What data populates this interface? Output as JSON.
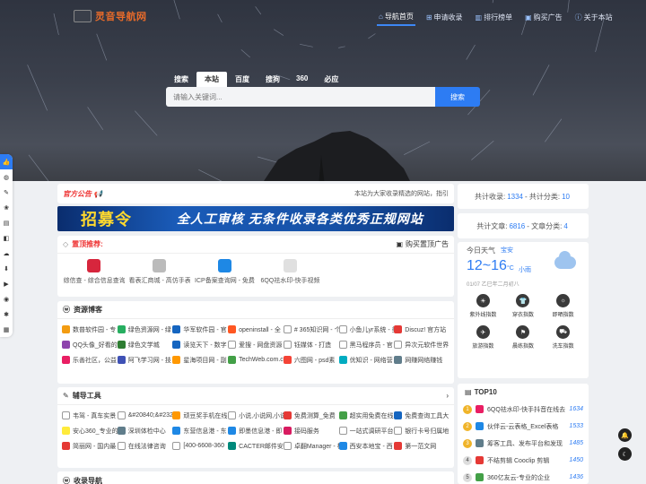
{
  "header": {
    "logo_text": "灵音导航网",
    "nav": [
      {
        "label": "导航首页",
        "icon": "home-icon"
      },
      {
        "label": "申请收录",
        "icon": "plus-icon"
      },
      {
        "label": "排行榜单",
        "icon": "bar-chart-icon"
      },
      {
        "label": "购买广告",
        "icon": "cart-icon"
      },
      {
        "label": "关于本站",
        "icon": "info-icon"
      }
    ]
  },
  "search": {
    "tabs": [
      "搜索",
      "本站",
      "百度",
      "搜狗",
      "360",
      "必应"
    ],
    "placeholder": "请输入关键词...",
    "button": "搜索"
  },
  "notice": {
    "title": "官方公告",
    "message": "本站为大家收录精选的网站，指引"
  },
  "banner": {
    "headline": "招募令",
    "slogan": "全人工审核  无条件收录各类优秀正规网站"
  },
  "top_recommend": {
    "title": "置顶推荐:",
    "buy": "购买置顶广告",
    "items": [
      {
        "name": "综信查 - 综合信息查询",
        "color": "#d7263d"
      },
      {
        "name": "看表汇商城 - 高仿手表",
        "color": "#bbbbbb"
      },
      {
        "name": "ICP备案查询网 - 免费",
        "color": "#1e88e5"
      },
      {
        "name": "6QQ祛水印-快手视频",
        "color": "#e0e0e0"
      }
    ]
  },
  "resources": {
    "title": "资源博客",
    "items": [
      {
        "name": "数普软件园 - 专",
        "color": "#f39c12"
      },
      {
        "name": "绿色资源网 - 绿",
        "color": "#27ae60"
      },
      {
        "name": "华军软件园 - 官",
        "color": "#1565c0"
      },
      {
        "name": "openinstall - 全",
        "color": "#ff5722"
      },
      {
        "name": "# 365知识网 - 个",
        "color": "#ffffff"
      },
      {
        "name": "小鱼儿yr系统 - 美",
        "color": "#ffffff"
      },
      {
        "name": "Discuz! 官方站",
        "color": "#e53935"
      },
      {
        "name": "QQ头像_好看的",
        "color": "#8e44ad"
      },
      {
        "name": "绿色文学城",
        "color": "#2e7d32"
      },
      {
        "name": "读览天下 - 数字",
        "color": "#1565c0"
      },
      {
        "name": "爱搜 - 网盘资源",
        "color": "#ffffff"
      },
      {
        "name": "钰媒体 - 打造",
        "color": "#ffffff"
      },
      {
        "name": "黑马程序员 - 官",
        "color": "#ffffff"
      },
      {
        "name": "异次元软件世界",
        "color": "#ffffff"
      },
      {
        "name": "乐善社区，公益",
        "color": "#e91e63"
      },
      {
        "name": "阿飞学习网 - 技",
        "color": "#3f51b5"
      },
      {
        "name": "星海项目网 - 副",
        "color": "#ff9800"
      },
      {
        "name": "TechWeb.com.cn",
        "color": "#43a047"
      },
      {
        "name": "六图网 - psd素",
        "color": "#f44336"
      },
      {
        "name": "优知识 - 网络营",
        "color": "#00acc1"
      },
      {
        "name": "网赚网络赚钱",
        "color": "#607d8b"
      }
    ]
  },
  "tools": {
    "title": "辅导工具",
    "items": [
      {
        "name": "韦驾 - 真车实景",
        "color": "#ffffff"
      },
      {
        "name": "&#20840;&#23233;",
        "color": "#ffffff"
      },
      {
        "name": "顽豆奖手机在线",
        "color": "#ff9800"
      },
      {
        "name": "小说,小说网,小说",
        "color": "#ffffff"
      },
      {
        "name": "免费测算_免费",
        "color": "#e53935"
      },
      {
        "name": "超实用免费在线",
        "color": "#43a047"
      },
      {
        "name": "免费查询工具大",
        "color": "#1565c0"
      },
      {
        "name": "安心360_专业的",
        "color": "#ffeb3b"
      },
      {
        "name": "深圳体检中心",
        "color": "#607d8b"
      },
      {
        "name": "东营信息港 - 东",
        "color": "#1e88e5"
      },
      {
        "name": "即墨信息港 - 即",
        "color": "#1e88e5"
      },
      {
        "name": "接码服务",
        "color": "#d81b60"
      },
      {
        "name": "一站式调研平台",
        "color": "#ffffff"
      },
      {
        "name": "银行卡号归属地",
        "color": "#ffffff"
      },
      {
        "name": "简丽网 - 国内最",
        "color": "#e53935"
      },
      {
        "name": "在线法律咨询",
        "color": "#ffffff"
      },
      {
        "name": "[400-6608-360",
        "color": "#ffffff"
      },
      {
        "name": "CACTER邮件安全",
        "color": "#00897b"
      },
      {
        "name": "卓翻Manager - 极",
        "color": "#ffffff"
      },
      {
        "name": "西安本地宝 - 西",
        "color": "#1e88e5"
      },
      {
        "name": "第一范文网",
        "color": "#e53935"
      }
    ]
  },
  "collect": {
    "title": "收录导航"
  },
  "stats": {
    "links_label": "共计收录:",
    "links_count": "1334",
    "cats_label": "- 共计分类:",
    "cats_count": "10",
    "articles_label": "共计文章:",
    "articles_count": "6816",
    "acats_label": "- 文章分类:",
    "acats_count": "4"
  },
  "weather": {
    "title": "今日天气",
    "city": "宝安",
    "temp": "12~16",
    "unit": "°C",
    "desc": "小雨",
    "date": "01/07 乙巳年二月初八",
    "indices": [
      "紫外线指数",
      "穿衣指数",
      "即晒指数",
      "旅游指数",
      "晨练指数",
      "洗车指数"
    ]
  },
  "top10": {
    "title": "TOP10",
    "items": [
      {
        "rank": "1",
        "name": "6QQ祛水印-快手抖音在线去水印",
        "value": "1634",
        "color": "#e91e63"
      },
      {
        "rank": "2",
        "name": "伙伴云-云表格_Excel表格",
        "value": "1533",
        "color": "#1e88e5"
      },
      {
        "rank": "3",
        "name": "筹客工具、发布平台和发现",
        "value": "1485",
        "color": "#607d8b"
      },
      {
        "rank": "4",
        "name": "不结剪辑 Cooclip 剪辑",
        "value": "1450",
        "color": "#e53935"
      },
      {
        "rank": "5",
        "name": "360亿友云-专业的企业",
        "value": "1436",
        "color": "#43a047"
      }
    ]
  },
  "left_icons": [
    "thumb-up-icon",
    "globe-icon",
    "hammer-icon",
    "paw-icon",
    "chart-icon",
    "layers-icon",
    "cloud-icon",
    "download-icon",
    "video-icon",
    "target-icon",
    "atom-icon",
    "bus-icon"
  ],
  "right_icons": [
    "bell-icon",
    "moon-icon"
  ]
}
